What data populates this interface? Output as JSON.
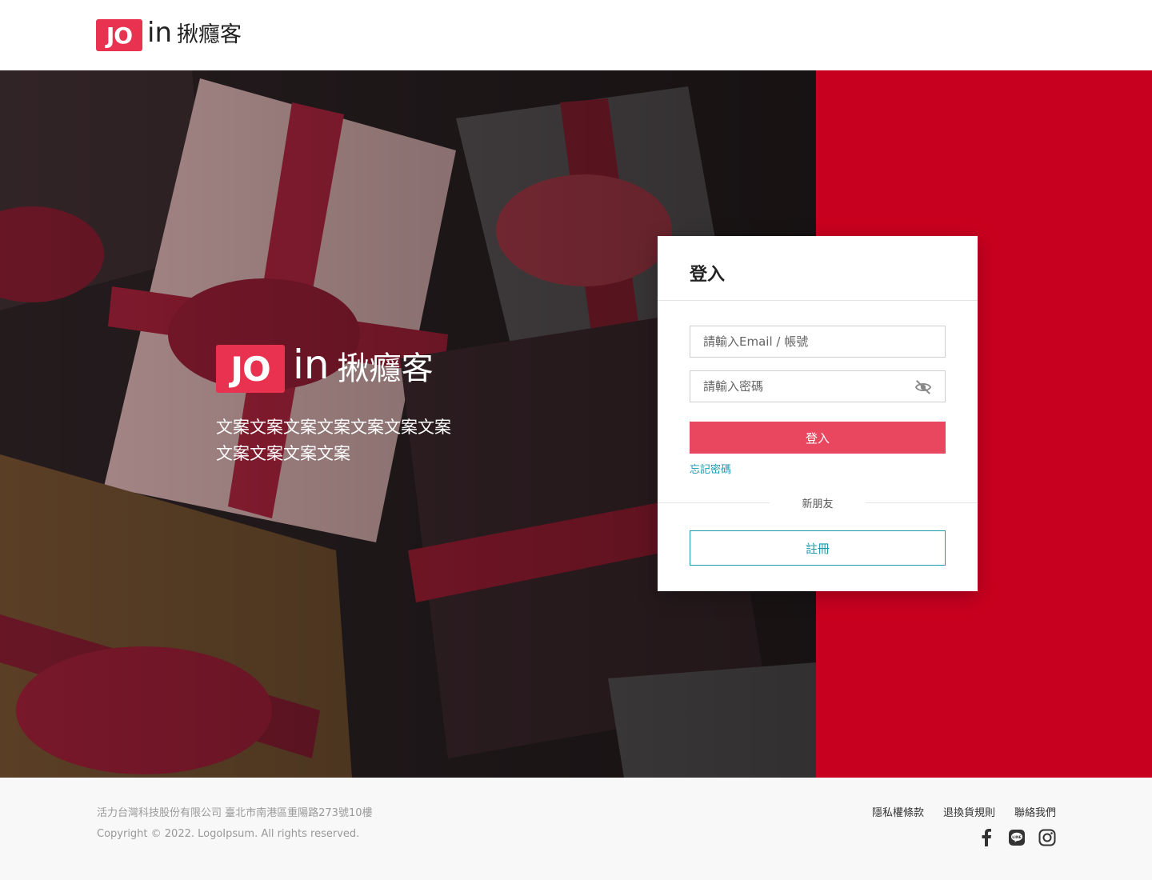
{
  "header": {
    "logo": {
      "jo": "JO",
      "in": "in",
      "cn": "揪癮客"
    }
  },
  "hero": {
    "logo": {
      "jo": "JO",
      "in": "in",
      "cn": "揪癮客"
    },
    "tagline": "文案文案文案文案文案文案文案文案文案文案文案",
    "colors": {
      "photo_tint": "#241b1c",
      "side_panel": "#c8001f"
    }
  },
  "login": {
    "title": "登入",
    "email_placeholder": "請輸入Email / 帳號",
    "password_placeholder": "請輸入密碼",
    "password_toggle_icon": "eye-off-icon",
    "submit_label": "登入",
    "forgot_label": "忘記密碼",
    "separator_label": "新朋友",
    "register_label": "註冊",
    "colors": {
      "primary": "#e8475f",
      "link": "#1a9bb0"
    }
  },
  "footer": {
    "company": "活力台灣科技股份有限公司  臺北市南港區重陽路273號10樓",
    "copyright": "Copyright © 2022. LogoIpsum. All rights reserved.",
    "links": [
      {
        "label": "隱私權條款"
      },
      {
        "label": "退換貨規則"
      },
      {
        "label": "聯絡我們"
      }
    ],
    "social": [
      {
        "icon": "facebook-icon"
      },
      {
        "icon": "line-icon"
      },
      {
        "icon": "instagram-icon"
      }
    ]
  }
}
